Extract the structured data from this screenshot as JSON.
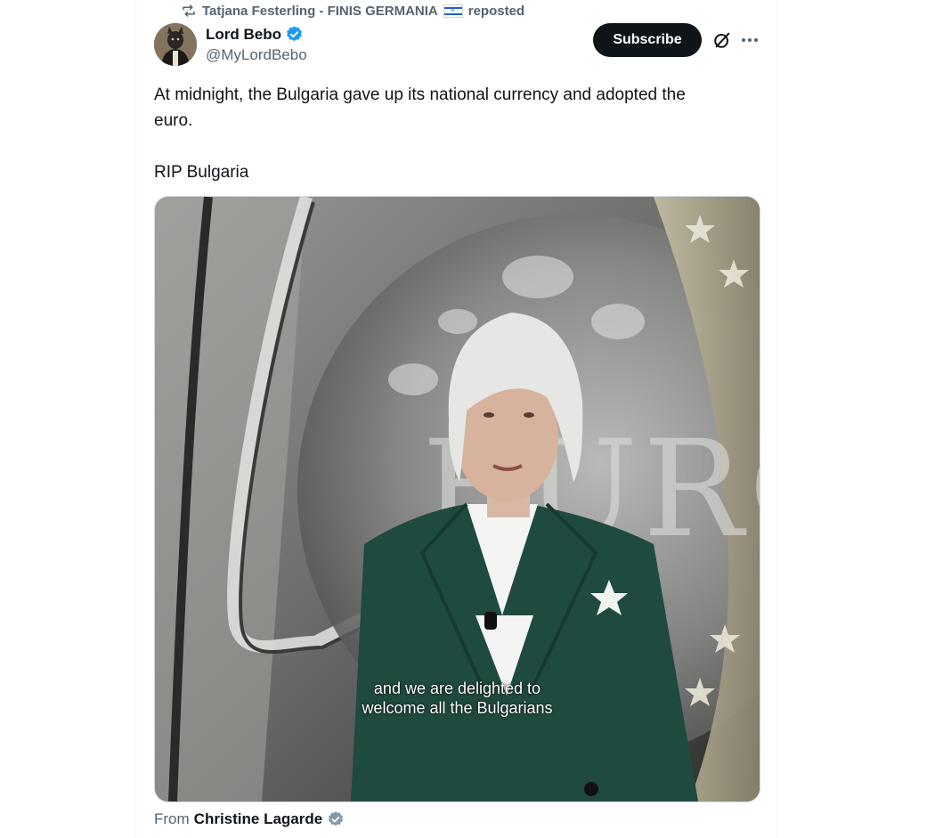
{
  "repost": {
    "reposter": "Tatjana Festerling - FINIS GERMANIA",
    "flag_icon": "israel-flag-icon",
    "suffix": "reposted"
  },
  "author": {
    "display_name": "Lord Bebo",
    "handle": "@MyLordBebo",
    "verified_color": "#1d9bf0"
  },
  "actions": {
    "subscribe_label": "Subscribe"
  },
  "tweet": {
    "text": "At midnight, the Bulgaria gave up its national currency and adopted the\neuro.\n\nRIP Bulgaria"
  },
  "media": {
    "caption_line1": "and we are delighted to",
    "caption_line2": "welcome all the Bulgarians",
    "coin_lettering": "EURO"
  },
  "attribution": {
    "prefix": "From",
    "source_name": "Christine Lagarde",
    "badge_color": "#829aab"
  },
  "colors": {
    "subscribe_bg": "#0f1419",
    "secondary_text": "#536471",
    "jacket": "#1f4a40"
  }
}
